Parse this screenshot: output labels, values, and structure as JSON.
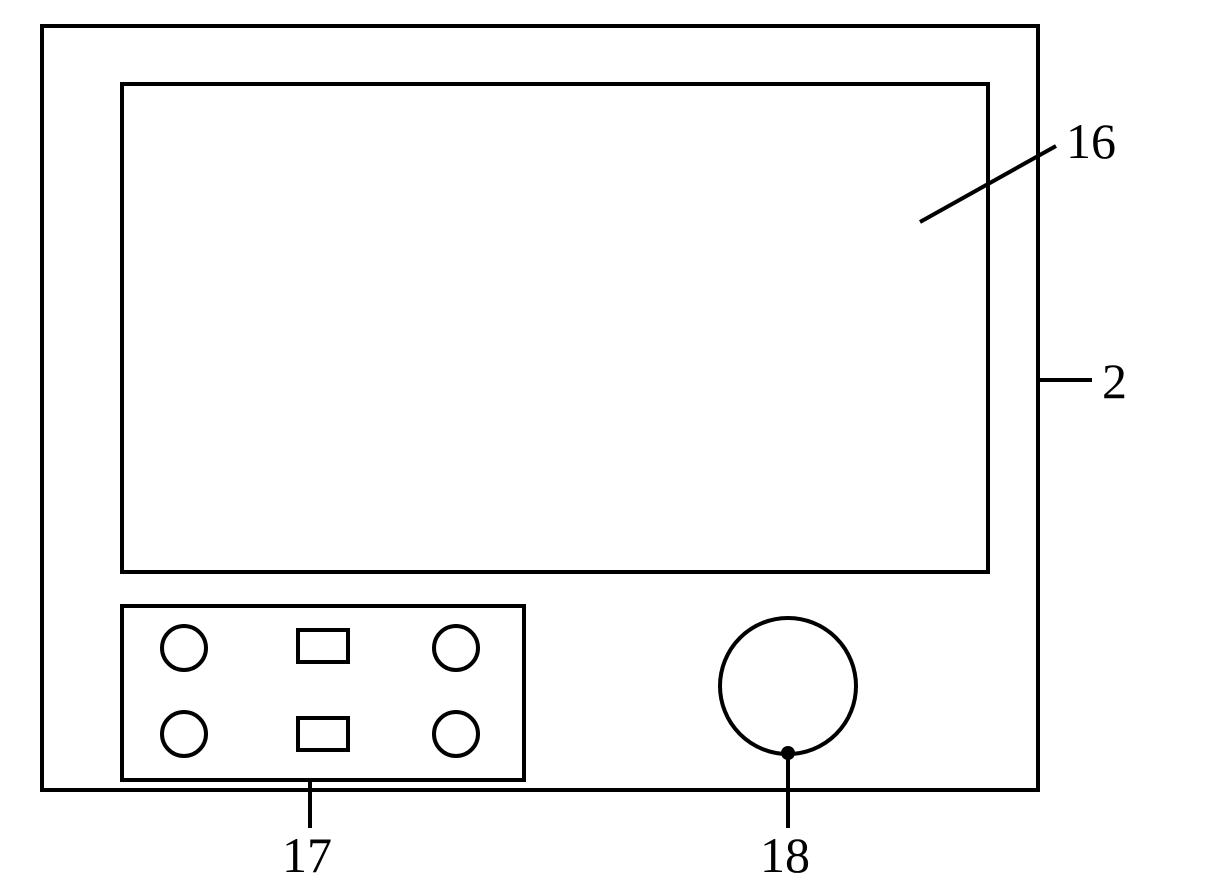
{
  "labels": {
    "screen": "16",
    "bezel": "2",
    "button_panel": "17",
    "knob": "18"
  }
}
